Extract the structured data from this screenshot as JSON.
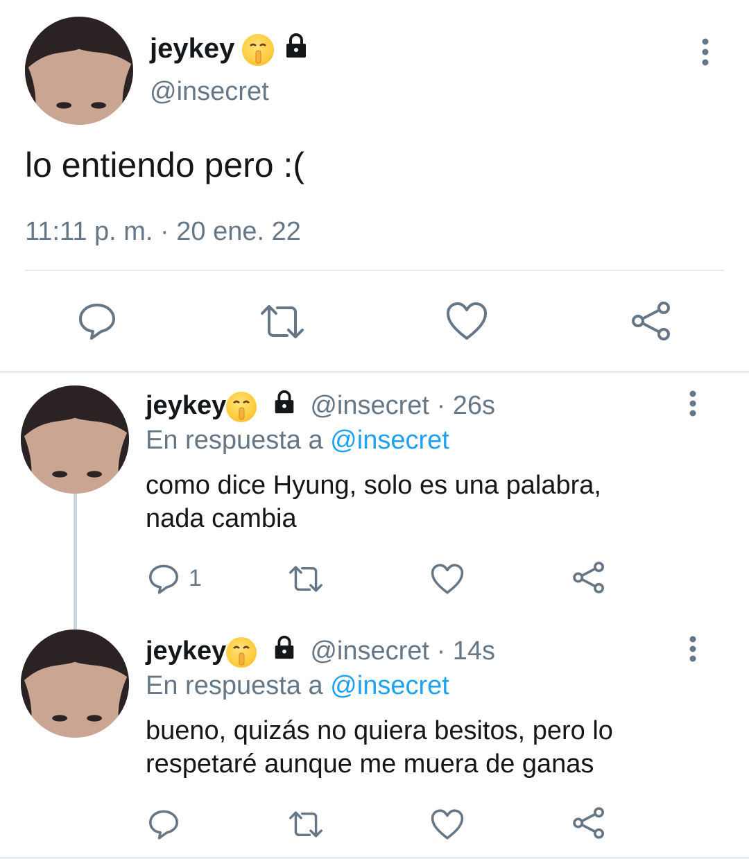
{
  "main_tweet": {
    "display_name": "jeykey",
    "handle": "@insecret",
    "text": "lo entiendo pero :(",
    "timestamp": "11:11 p. m. · 20 ene. 22",
    "actions": [
      "reply-icon",
      "retweet-icon",
      "like-icon",
      "share-icon"
    ]
  },
  "replies": [
    {
      "display_name": "jeykey",
      "handle": "@insecret",
      "time_ago": "· 26s",
      "reply_prefix": "En respuesta a",
      "reply_to": "@insecret",
      "text_line1": "como dice Hyung, solo es una palabra,",
      "text_line2": "nada cambia",
      "reply_count": "1"
    },
    {
      "display_name": "jeykey",
      "handle": "@insecret",
      "time_ago": "· 14s",
      "reply_prefix": "En respuesta a",
      "reply_to": "@insecret",
      "text_line1": "bueno, quizás no quiera besitos, pero lo",
      "text_line2": "respetaré aunque me muera de ganas",
      "reply_count": ""
    }
  ],
  "colors": {
    "text": "#14171a",
    "muted": "#657786",
    "link": "#1da1f2",
    "divider": "#e6ecf0"
  }
}
